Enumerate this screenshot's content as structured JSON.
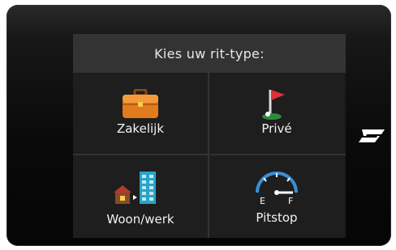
{
  "dialog": {
    "title": "Kies uw rit-type:"
  },
  "options": [
    {
      "label": "Zakelijk",
      "icon": "briefcase-icon"
    },
    {
      "label": "Privé",
      "icon": "golf-flag-icon"
    },
    {
      "label": "Woon/werk",
      "icon": "home-to-office-icon"
    },
    {
      "label": "Pitstop",
      "icon": "fuel-gauge-icon"
    }
  ],
  "gauge": {
    "empty_label": "E",
    "full_label": "F"
  },
  "colors": {
    "title_bar": "#333333",
    "tile_bg": "#1e1e1e",
    "briefcase": "#e27a1e",
    "flag": "#e0303a",
    "building": "#2aa3c8",
    "gauge_arc": "#3a8fd6"
  }
}
